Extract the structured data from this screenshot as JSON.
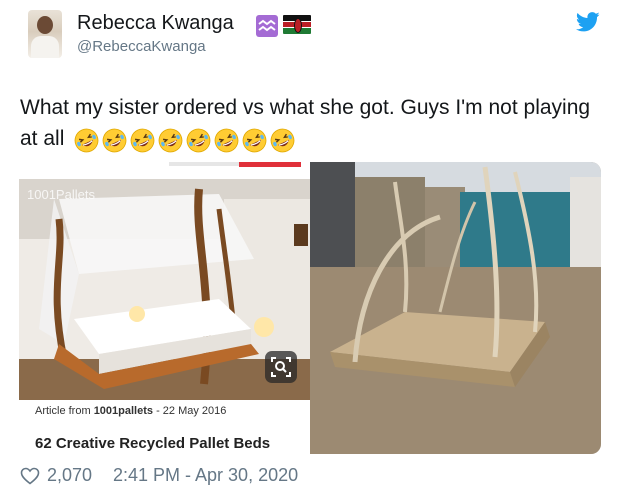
{
  "tweet": {
    "author": {
      "display_name": "Rebecca Kwanga",
      "handle": "@RebeccaKwanga",
      "badges": [
        "aquarius-icon",
        "kenya-flag-icon"
      ]
    },
    "text": "What my sister ordered vs what she got. Guys I'm not playing at all",
    "emoji": "rolling-on-the-floor-laughing",
    "emoji_count": 8,
    "likes": "2,070",
    "timestamp": "2:41 PM - Apr 30, 2020"
  },
  "media": {
    "left_card": {
      "watermark": "1001Pallets",
      "article_prefix": "Article from",
      "article_source": "1001pallets",
      "article_date": "- 22 May 2016",
      "article_title": "62 Creative Recycled Pallet Beds"
    }
  },
  "colors": {
    "twitter_blue": "#1da1f2",
    "secondary_text": "#657786",
    "primary_text": "#14171a"
  }
}
